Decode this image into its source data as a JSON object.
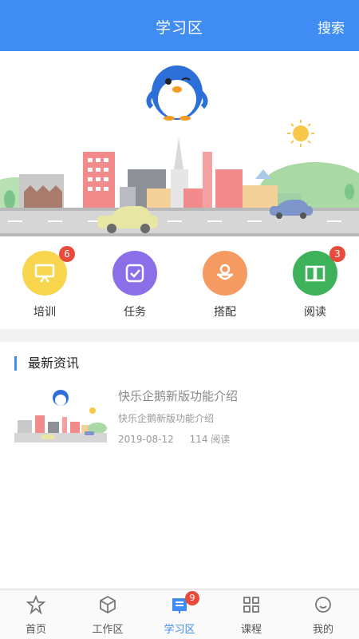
{
  "header": {
    "title": "学习区",
    "search_label": "搜索"
  },
  "shortcuts": [
    {
      "label": "培训",
      "badge": "6",
      "icon": "presentation-board-icon",
      "color": "#f7d64e"
    },
    {
      "label": "任务",
      "badge": "",
      "icon": "check-box-icon",
      "color": "#8a6fe8"
    },
    {
      "label": "搭配",
      "badge": "",
      "icon": "puzzle-icon",
      "color": "#f59a61"
    },
    {
      "label": "阅读",
      "badge": "3",
      "icon": "open-book-icon",
      "color": "#3db25a"
    }
  ],
  "news": {
    "section_title": "最新资讯",
    "items": [
      {
        "title": "快乐企鹅新版功能介绍",
        "summary": "快乐企鹅新版功能介绍",
        "date": "2019-08-12",
        "reads": "114 阅读"
      }
    ]
  },
  "tabbar": {
    "items": [
      {
        "label": "首页",
        "icon": "star-home-icon",
        "active": false
      },
      {
        "label": "工作区",
        "icon": "cube-icon",
        "active": false
      },
      {
        "label": "学习区",
        "icon": "document-icon",
        "active": true,
        "badge": "9"
      },
      {
        "label": "课程",
        "icon": "grid-icon",
        "active": false
      },
      {
        "label": "我的",
        "icon": "smiley-icon",
        "active": false
      }
    ]
  },
  "colors": {
    "primary": "#3f8cf2",
    "badge": "#e84b3c"
  }
}
